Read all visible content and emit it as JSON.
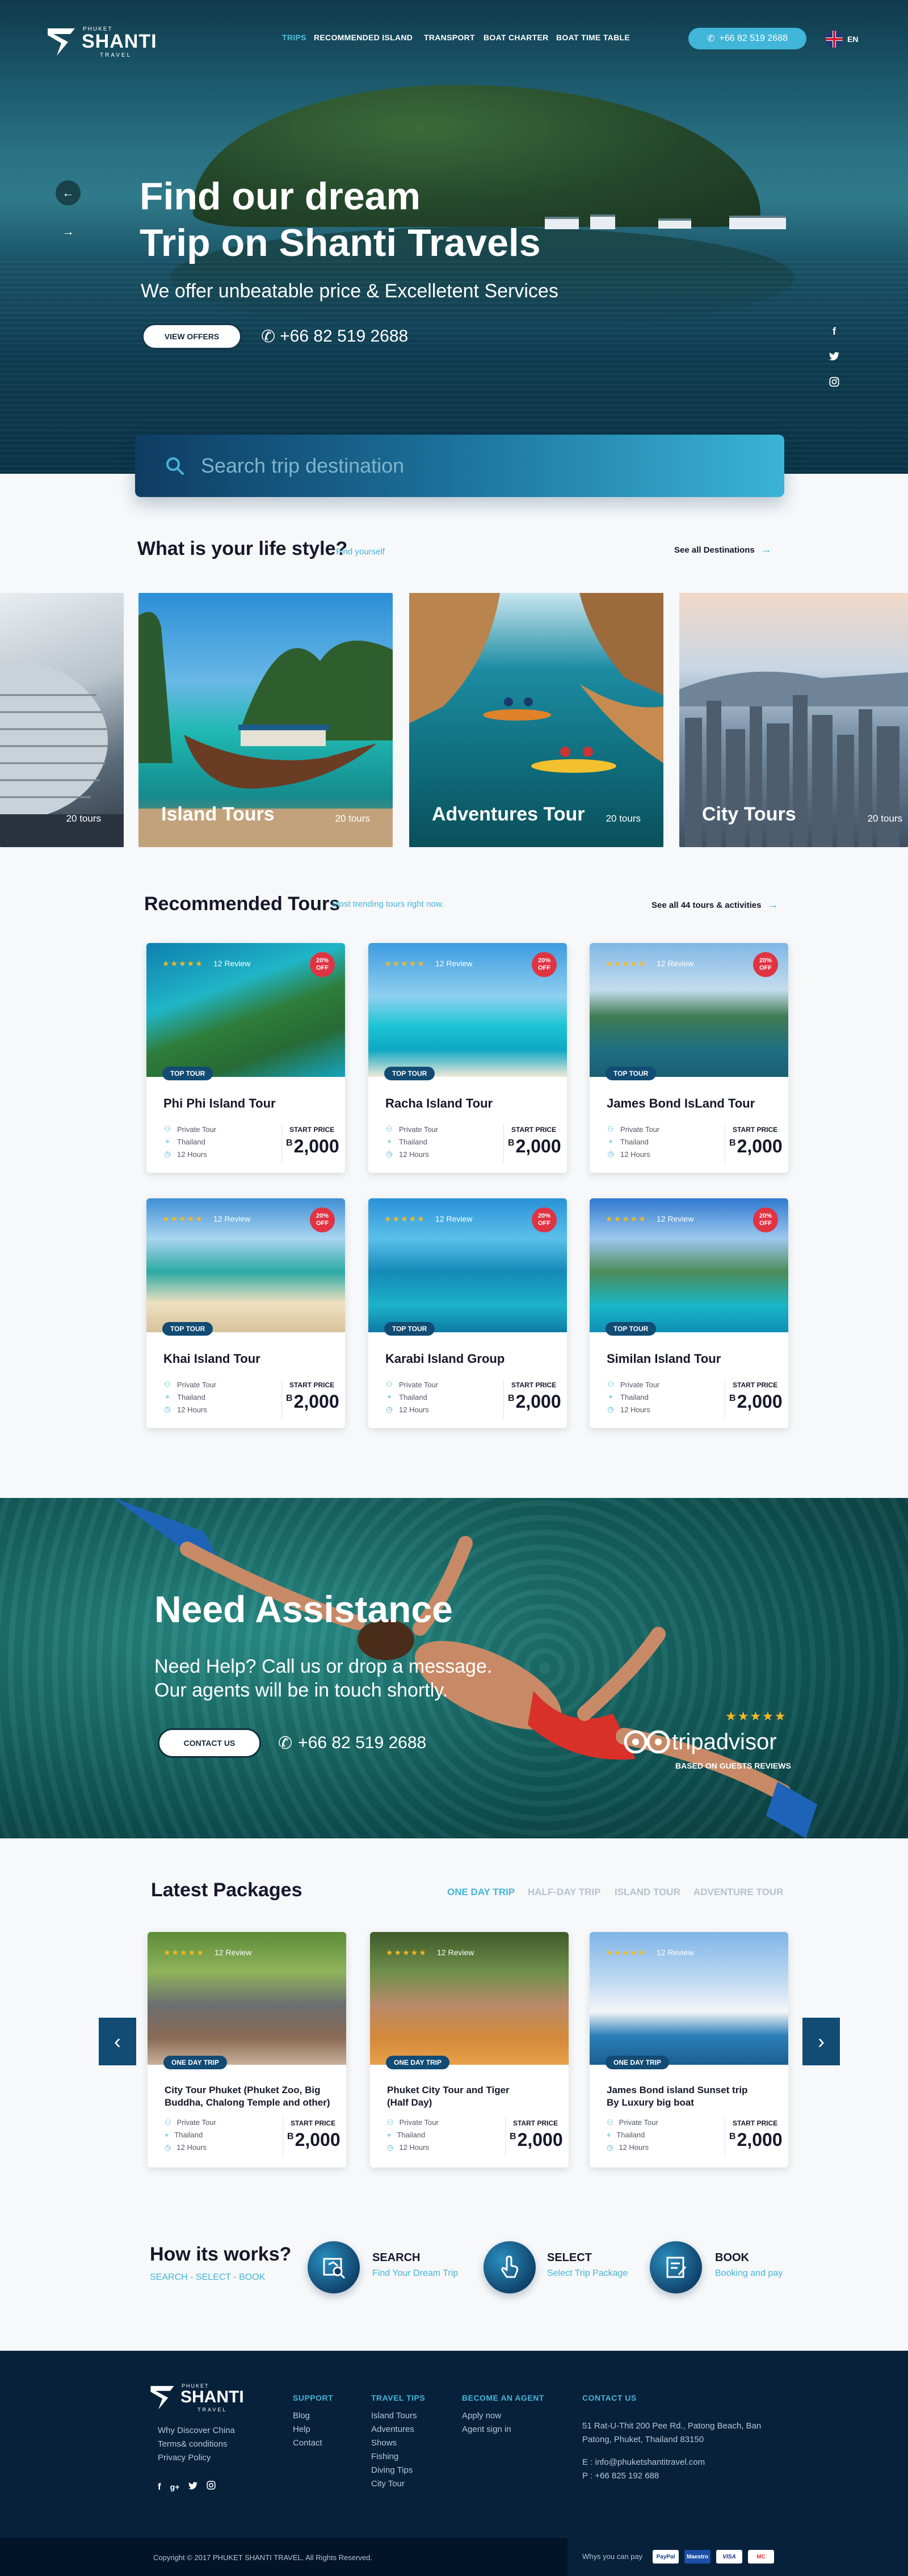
{
  "header": {
    "logo": {
      "top": "PHUKET",
      "name": "SHANTI",
      "bottom": "TRAVEL"
    },
    "nav": [
      "TRIPS",
      "RECOMMENDED ISLAND",
      "TRANSPORT",
      "BOAT CHARTER",
      "BOAT TIME TABLE"
    ],
    "phone": "+66 82 519 2688",
    "language": "EN"
  },
  "hero": {
    "title_line1": "Find our dream",
    "title_line2": "Trip on Shanti Travels",
    "subtitle": "We offer unbeatable price & Excelletent Services",
    "cta": "VIEW OFFERS",
    "phone": "+66 82 519 2688"
  },
  "search": {
    "placeholder": "Search trip destination"
  },
  "lifestyle": {
    "title": "What is your life style?",
    "subtitle": "Find yourself",
    "see_all": "See  all  Destinations",
    "cards": [
      {
        "label": "",
        "count": "20 tours"
      },
      {
        "label": "Island Tours",
        "count": "20 tours"
      },
      {
        "label": "Adventures Tour",
        "count": "20 tours"
      },
      {
        "label": "City Tours",
        "count": "20 tours"
      }
    ]
  },
  "recommended": {
    "title": "Recommended Tours",
    "subtitle": "Most trending tours right now.",
    "see_all": "See  all  44  tours  &  activities",
    "common": {
      "stars": "★★★★★",
      "reviews": "12 Review",
      "discount_top": "20%",
      "discount_bottom": "OFF",
      "badge": "TOP TOUR",
      "type": "Private Tour",
      "country": "Thailand",
      "duration": "12 Hours",
      "start_label": "START PRICE",
      "currency": "B",
      "price": "2,000"
    },
    "tours": [
      "Phi Phi Island Tour",
      "Racha Island Tour",
      "James Bond IsLand Tour",
      "Khai Island Tour",
      "Karabi Island Group",
      "Similan Island Tour"
    ]
  },
  "assistance": {
    "title": "Need Assistance",
    "text_line1": "Need Help? Call us or drop a message.",
    "text_line2": "Our agents will be in touch shortly.",
    "cta": "CONTACT US",
    "phone": "+66 82 519 2688",
    "tripadvisor": {
      "stars": "★★★★★",
      "brand": "tripadvisor",
      "note": "BASED ON GUESTS REVIEWS"
    }
  },
  "packages": {
    "title": "Latest Packages",
    "tabs": [
      "ONE DAY TRIP",
      "HALF-DAY TRIP",
      "ISLAND TOUR",
      "ADVENTURE TOUR"
    ],
    "badge": "ONE DAY TRIP",
    "items": [
      {
        "name_line1": "City Tour Phuket (Phuket Zoo, Big",
        "name_line2": "Buddha, Chalong Temple and other)"
      },
      {
        "name_line1": "Phuket City Tour and Tiger",
        "name_line2": "(Half Day)"
      },
      {
        "name_line1": "James Bond island Sunset trip",
        "name_line2": "By Luxury big boat"
      }
    ]
  },
  "how": {
    "title": "How its works?",
    "subtitle": "SEARCH - SELECT - BOOK",
    "steps": [
      {
        "title": "SEARCH",
        "sub": "Find Your Dream Trip"
      },
      {
        "title": "SELECT",
        "sub": "Select Trip Package"
      },
      {
        "title": "BOOK",
        "sub": "Booking and pay"
      }
    ]
  },
  "footer": {
    "links_col0": [
      "Why Discover China",
      "Terms& conditions",
      "Privacy Policy"
    ],
    "support": {
      "title": "SUPPORT",
      "items": [
        "Blog",
        "Help",
        "Contact"
      ]
    },
    "travel_tips": {
      "title": "TRAVEL TIPS",
      "items": [
        "Island Tours",
        "Adventures",
        "Shows",
        "Fishing",
        "Diving Tips",
        "City Tour"
      ]
    },
    "agent": {
      "title": "BECOME AN AGENT",
      "items": [
        "Apply now",
        "Agent sign in"
      ]
    },
    "contact": {
      "title": "CONTACT US",
      "address_line1": "51 Rat-U-Thit 200 Pee Rd., Patong Beach, Ban",
      "address_line2": "Patong, Phuket, Thailand 83150",
      "email": "E : info@phuketshantitravel.com",
      "phone": "P : +66 825 192 688"
    },
    "copyright": "Copyright © 2017 PHUKET SHANTI TRAVEL. All Rights Reserved.",
    "pay_label": "Whys you can pay",
    "cards": [
      "PayPal",
      "Maestro",
      "VISA",
      "MC"
    ]
  },
  "colors": {
    "accent": "#45b5d8",
    "navy": "#124b73",
    "footer": "#07213b",
    "discount": "#e03343"
  }
}
